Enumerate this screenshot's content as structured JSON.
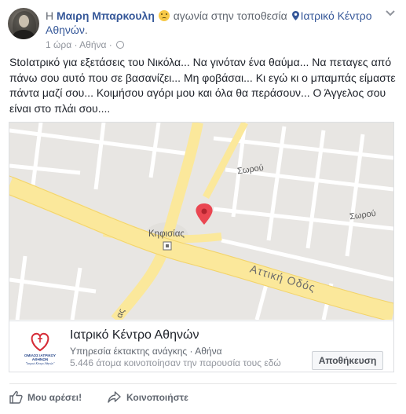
{
  "post": {
    "header_prefix": "Η ",
    "author": "Μαιρη Μπαρκουλη",
    "feeling": "αγωνία στην τοποθεσία",
    "place_line1": "Ιατρικό Κέντρο",
    "place_line2": "Αθηνών",
    "time": "1 ώρα",
    "separator": "·",
    "location": "Αθήνα",
    "text": "StoΙατρικό για εξετάσεις του Νικόλα... Να γινόταν ένα θαύμα... Να πεταγες από πάνω σου αυτό που σε βασανίζει... Μη φοβάσαι... Κι εγώ κι ο μπαμπάς είμαστε πάντα μαζί σου... Κοιμήσου αγόρι μου και όλα θα περάσουν... Ο Άγγελος σου είναι στο πλάι σου...."
  },
  "map": {
    "labels": {
      "sorou_1": "Σωρού",
      "sorou_2": "Σωρού",
      "kifisias": "Κηφισίας",
      "attiki": "Αττική  Οδός",
      "partial": "ας"
    },
    "colors": {
      "land": "#e8e6e3",
      "road_major": "#fbe89b",
      "road_minor": "#ffffff",
      "pin": "#ea4651"
    }
  },
  "place_card": {
    "title": "Ιατρικό Κέντρο Αθηνών",
    "category": "Υπηρεσία έκτακτης ανάγκης",
    "city": "Αθήνα",
    "shares": "5.446 άτομα κοινοποίησαν την παρουσία τους εδώ",
    "save_label": "Αποθήκευση",
    "logo_line1": "ΟΜΙΛΟΣ ΙΑΤΡΙΚΟΥ",
    "logo_line2": "ΑΘΗΝΩΝ",
    "logo_line3": "\"Ιατρικό Κέντρο Αθηνών\""
  },
  "actions": {
    "like_label": "Μου αρέσει!",
    "share_label": "Κοινοποιήστε"
  }
}
